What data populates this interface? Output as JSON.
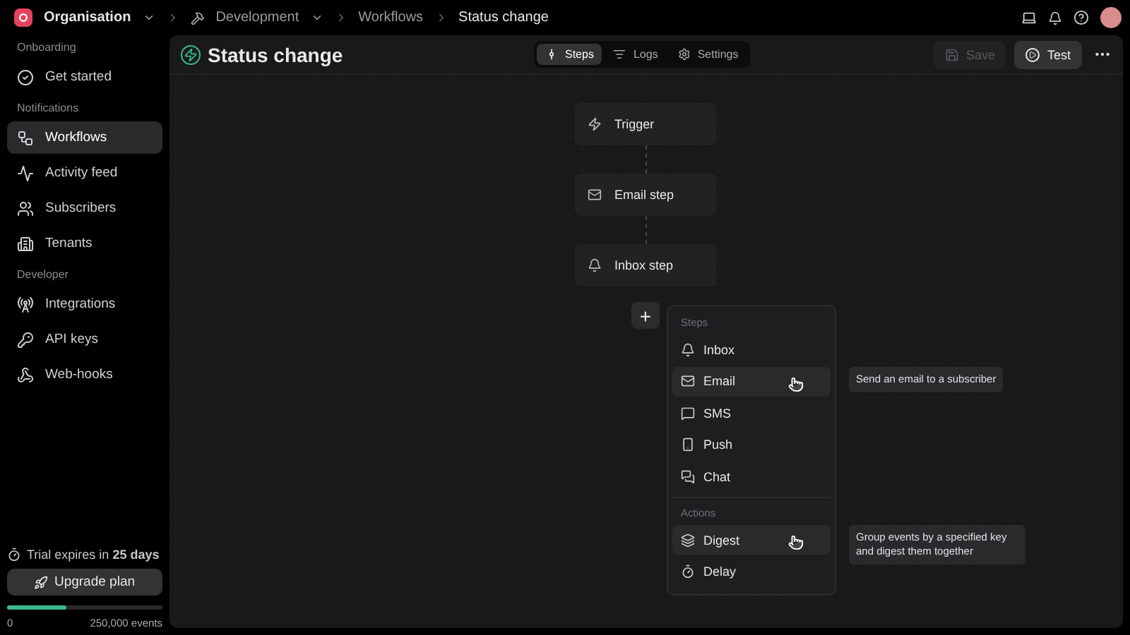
{
  "topbar": {
    "organisation": "Organisation",
    "breadcrumbs": [
      {
        "label": "Development",
        "kind": "environment"
      },
      {
        "label": "Workflows",
        "kind": "link"
      },
      {
        "label": "Status change",
        "kind": "current"
      }
    ]
  },
  "sidebar": {
    "sections": [
      {
        "heading": "Onboarding",
        "items": [
          {
            "label": "Get started",
            "kind": "check",
            "selected": false
          }
        ]
      },
      {
        "heading": "Notifications",
        "items": [
          {
            "label": "Workflows",
            "kind": "workflow",
            "selected": true
          },
          {
            "label": "Activity feed",
            "kind": "activity",
            "selected": false
          },
          {
            "label": "Subscribers",
            "kind": "users",
            "selected": false
          },
          {
            "label": "Tenants",
            "kind": "building",
            "selected": false
          }
        ]
      },
      {
        "heading": "Developer",
        "items": [
          {
            "label": "Integrations",
            "kind": "radio",
            "selected": false
          },
          {
            "label": "API keys",
            "kind": "key",
            "selected": false
          },
          {
            "label": "Web-hooks",
            "kind": "webhook",
            "selected": false
          }
        ]
      }
    ],
    "trial": {
      "text": "Trial expires in **25 days**",
      "button": "Upgrade plan",
      "usage_start": "0",
      "usage_end": "250,000 events",
      "level": 0.38
    }
  },
  "workflow": {
    "title": "Status change",
    "tabs": [
      {
        "label": "Steps",
        "kind": "steps",
        "selected": true
      },
      {
        "label": "Logs",
        "kind": "logs",
        "selected": false
      },
      {
        "label": "Settings",
        "kind": "settings",
        "selected": false
      }
    ],
    "save": {
      "label": "Save",
      "disabled": true
    },
    "test": {
      "label": "Test",
      "disabled": false
    }
  },
  "canvas": {
    "nodes": [
      {
        "label": "Trigger",
        "kind": "zap"
      },
      {
        "label": "Email step",
        "kind": "mail"
      },
      {
        "label": "Inbox step",
        "kind": "bell"
      }
    ],
    "add_button": "+",
    "menu": {
      "groups": [
        {
          "heading": "Steps",
          "items": [
            {
              "label": "Inbox",
              "kind": "bell",
              "highlighted": false
            },
            {
              "label": "Email",
              "kind": "mail",
              "highlighted": true,
              "tooltip": "Send an email to a subscriber"
            },
            {
              "label": "SMS",
              "kind": "sms",
              "highlighted": false
            },
            {
              "label": "Push",
              "kind": "phone",
              "highlighted": false
            },
            {
              "label": "Chat",
              "kind": "chat",
              "highlighted": false
            }
          ]
        },
        {
          "heading": "Actions",
          "items": [
            {
              "label": "Digest",
              "kind": "digest",
              "highlighted": true,
              "tooltip": "Group events by a specified key and digest them together"
            },
            {
              "label": "Delay",
              "kind": "timer",
              "highlighted": false
            }
          ]
        }
      ]
    }
  }
}
